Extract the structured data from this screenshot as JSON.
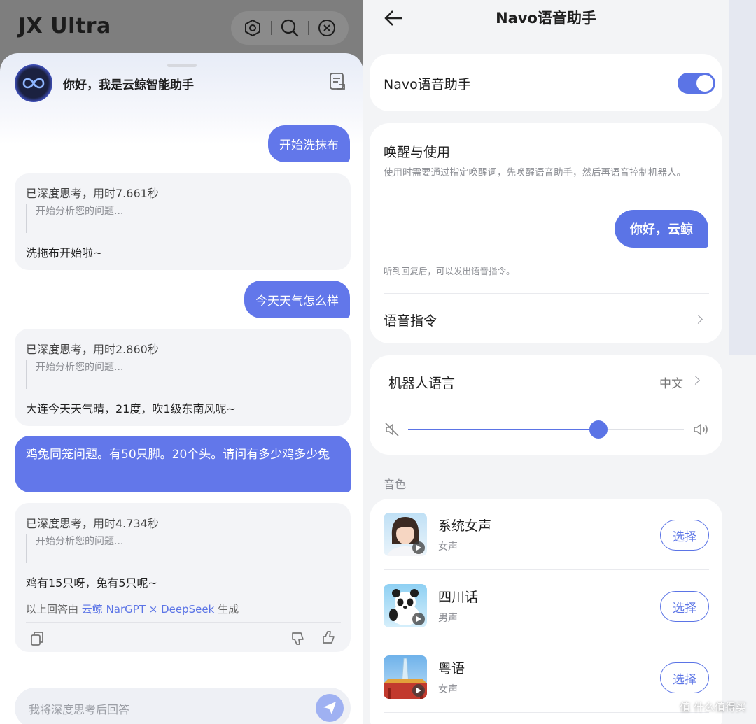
{
  "left": {
    "app_title": "JX Ultra",
    "greeting": "你好，我是云鲸智能助手",
    "messages": [
      {
        "role": "user",
        "text": "开始洗抹布"
      },
      {
        "role": "assistant",
        "think_title": "已深度思考，用时7.661秒",
        "think_quote": "开始分析您的问题...",
        "answer": "洗拖布开始啦~"
      },
      {
        "role": "user",
        "text": "今天天气怎么样"
      },
      {
        "role": "assistant",
        "think_title": "已深度思考，用时2.860秒",
        "think_quote": "开始分析您的问题...",
        "answer": "大连今天天气晴，21度，吹1级东南风呢~"
      },
      {
        "role": "user",
        "text": "鸡兔同笼问题。有50只脚。20个头。请问有多少鸡多少兔"
      },
      {
        "role": "assistant",
        "think_title": "已深度思考，用时4.734秒",
        "think_quote": "开始分析您的问题...",
        "answer": "鸡有15只呀，兔有5只呢~"
      }
    ],
    "credit_prefix": "以上回答由",
    "credit_link": "云鲸 NarGPT × DeepSeek",
    "credit_suffix": "生成",
    "input_placeholder": "我将深度思考后回答"
  },
  "right": {
    "title": "Navo语音助手",
    "assistant_label": "Navo语音助手",
    "assistant_enabled": true,
    "wake_title": "唤醒与使用",
    "wake_desc": "使用时需要通过指定唤醒词，先唤醒语音助手，然后再语音控制机器人。",
    "wake_bubble": "你好，云鲸",
    "wake_hint": "听到回复后，可以发出语音指令。",
    "voice_commands_label": "语音指令",
    "robot_language_label": "机器人语言",
    "robot_language_value": "中文",
    "volume_level": 0.69,
    "timbre_section_label": "音色",
    "voices": [
      {
        "name": "系统女声",
        "gender": "女声",
        "button": "选择"
      },
      {
        "name": "四川话",
        "gender": "男声",
        "button": "选择"
      },
      {
        "name": "粤语",
        "gender": "女声",
        "button": "选择"
      }
    ],
    "watermark": "值 什么值得买"
  },
  "colors": {
    "accent": "#5b74e6",
    "user_bubble": "#6277ea",
    "card_bg": "#f3f4f7"
  }
}
